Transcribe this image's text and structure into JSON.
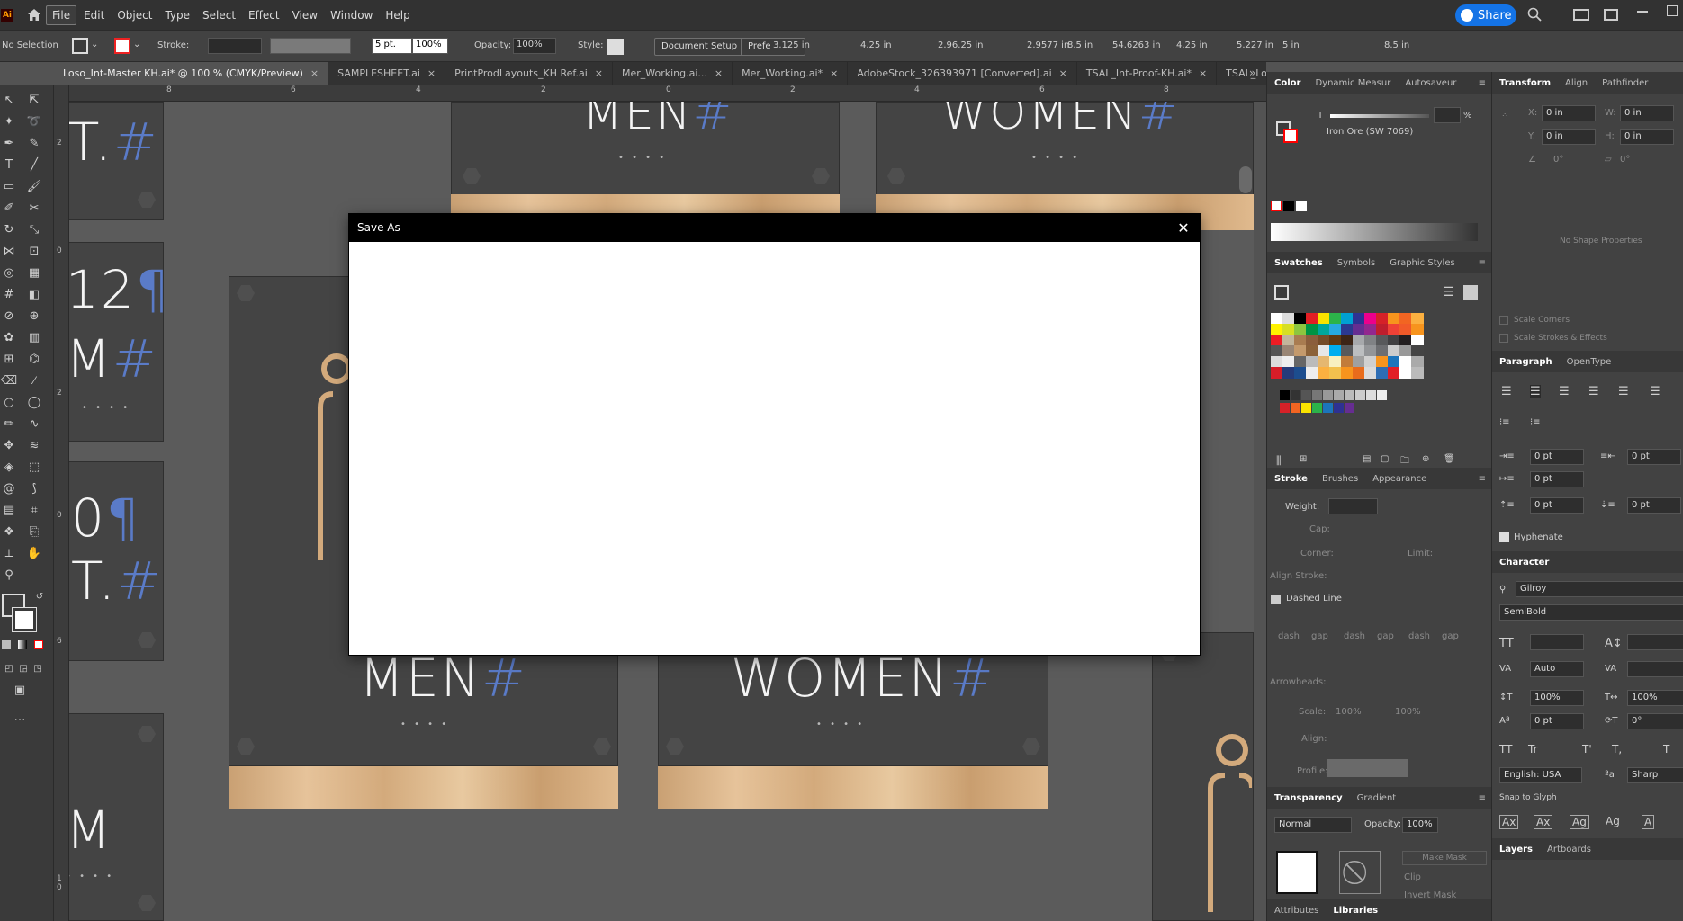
{
  "menubar": {
    "logo": "Ai",
    "items": [
      "File",
      "Edit",
      "Object",
      "Type",
      "Select",
      "Effect",
      "View",
      "Window",
      "Help"
    ],
    "share_label": "Share"
  },
  "controlbar": {
    "selection": "No Selection",
    "stroke_label": "Stroke:",
    "brush_size": "5 pt.",
    "brush_pct": "100%",
    "opacity_label": "Opacity:",
    "opacity_value": "100%",
    "style_label": "Style:",
    "doc_setup": "Document Setup",
    "prefs": "Prefe",
    "v1": "3.125 in",
    "v2": "4.25 in",
    "v3": "2.96.25 in",
    "v4": "2.9577 in",
    "v5": "8.5 in",
    "v6": "54.6263 in",
    "v7": "4.25 in",
    "v8": "5.227 in",
    "v9": "5 in",
    "v10": "8.5 in"
  },
  "tabs": [
    {
      "label": "Loso_Int-Master KH.ai* @ 100 % (CMYK/Preview)",
      "active": true
    },
    {
      "label": "SAMPLESHEET.ai"
    },
    {
      "label": "PrintProdLayouts_KH Ref.ai"
    },
    {
      "label": "Mer_Working.ai..."
    },
    {
      "label": "Mer_Working.ai*"
    },
    {
      "label": "AdobeStock_326393971 [Converted].ai"
    },
    {
      "label": "TSAL_Int-Proof-KH.ai*"
    },
    {
      "label": "TSAL_Logo"
    }
  ],
  "ruler_top": [
    "8",
    "6",
    "4",
    "2",
    "0",
    "2",
    "4",
    "6",
    "8"
  ],
  "ruler_left": [
    "2",
    "0",
    "2",
    "0",
    "6",
    "1\n0"
  ],
  "canvas": {
    "men": "MEN",
    "women": "WOMEN",
    "hash": "#",
    "t_hash": "T.",
    "n12": "12",
    "pilcrow": "¶",
    "m": "M",
    "zero": "0",
    "braille": "• • • •"
  },
  "dialog": {
    "title": "Save As",
    "close": "✕"
  },
  "color_panel": {
    "tabs": [
      "Color",
      "Dynamic Measur",
      "Autosaveur"
    ],
    "t_label": "T",
    "pct": "%",
    "color_name": "Iron Ore (SW 7069)"
  },
  "swatches_panel": {
    "tabs": [
      "Swatches",
      "Symbols",
      "Graphic Styles"
    ]
  },
  "stroke_panel": {
    "tabs": [
      "Stroke",
      "Brushes",
      "Appearance"
    ],
    "weight": "Weight:",
    "cap": "Cap:",
    "corner": "Corner:",
    "limit": "Limit:",
    "align": "Align Stroke:",
    "dashed": "Dashed Line",
    "dash": "dash",
    "gap": "gap",
    "arrowheads": "Arrowheads:",
    "scale": "Scale:",
    "scale1": "100%",
    "scale2": "100%",
    "align2": "Align:",
    "profile": "Profile:"
  },
  "transparency_panel": {
    "tabs": [
      "Transparency",
      "Gradient"
    ],
    "mode": "Normal",
    "opacity_label": "Opacity:",
    "opacity": "100%",
    "make_mask": "Make Mask",
    "clip": "Clip",
    "invert": "Invert Mask"
  },
  "bottom_tabs": [
    "Attributes",
    "Libraries"
  ],
  "transform_panel": {
    "tabs": [
      "Transform",
      "Align",
      "Pathfinder"
    ],
    "x": "X:",
    "x_val": "0 in",
    "y": "Y:",
    "y_val": "0 in",
    "w": "W:",
    "w_val": "0 in",
    "h": "H:",
    "h_val": "0 in",
    "angle": "0°",
    "shear": "0°",
    "no_shape": "No Shape Properties",
    "scale_corners": "Scale Corners",
    "scale_strokes": "Scale Strokes & Effects"
  },
  "paragraph_panel": {
    "tabs": [
      "Paragraph",
      "OpenType"
    ],
    "f1": "0 pt",
    "f2": "0 pt",
    "f3": "0 pt",
    "f4": "0 pt",
    "f5": "0 pt",
    "hyphenate": "Hyphenate"
  },
  "character_panel": {
    "tabs": [
      "Character"
    ],
    "font": "Gilroy",
    "style": "SemiBold",
    "auto": "Auto",
    "p100a": "100%",
    "p100b": "100%",
    "p0": "0 pt",
    "deg": "0°",
    "lang": "English: USA",
    "aa": "Sharp",
    "snap": "Snap to Glyph"
  },
  "layers_panel": {
    "tabs": [
      "Layers",
      "Artboards"
    ]
  }
}
